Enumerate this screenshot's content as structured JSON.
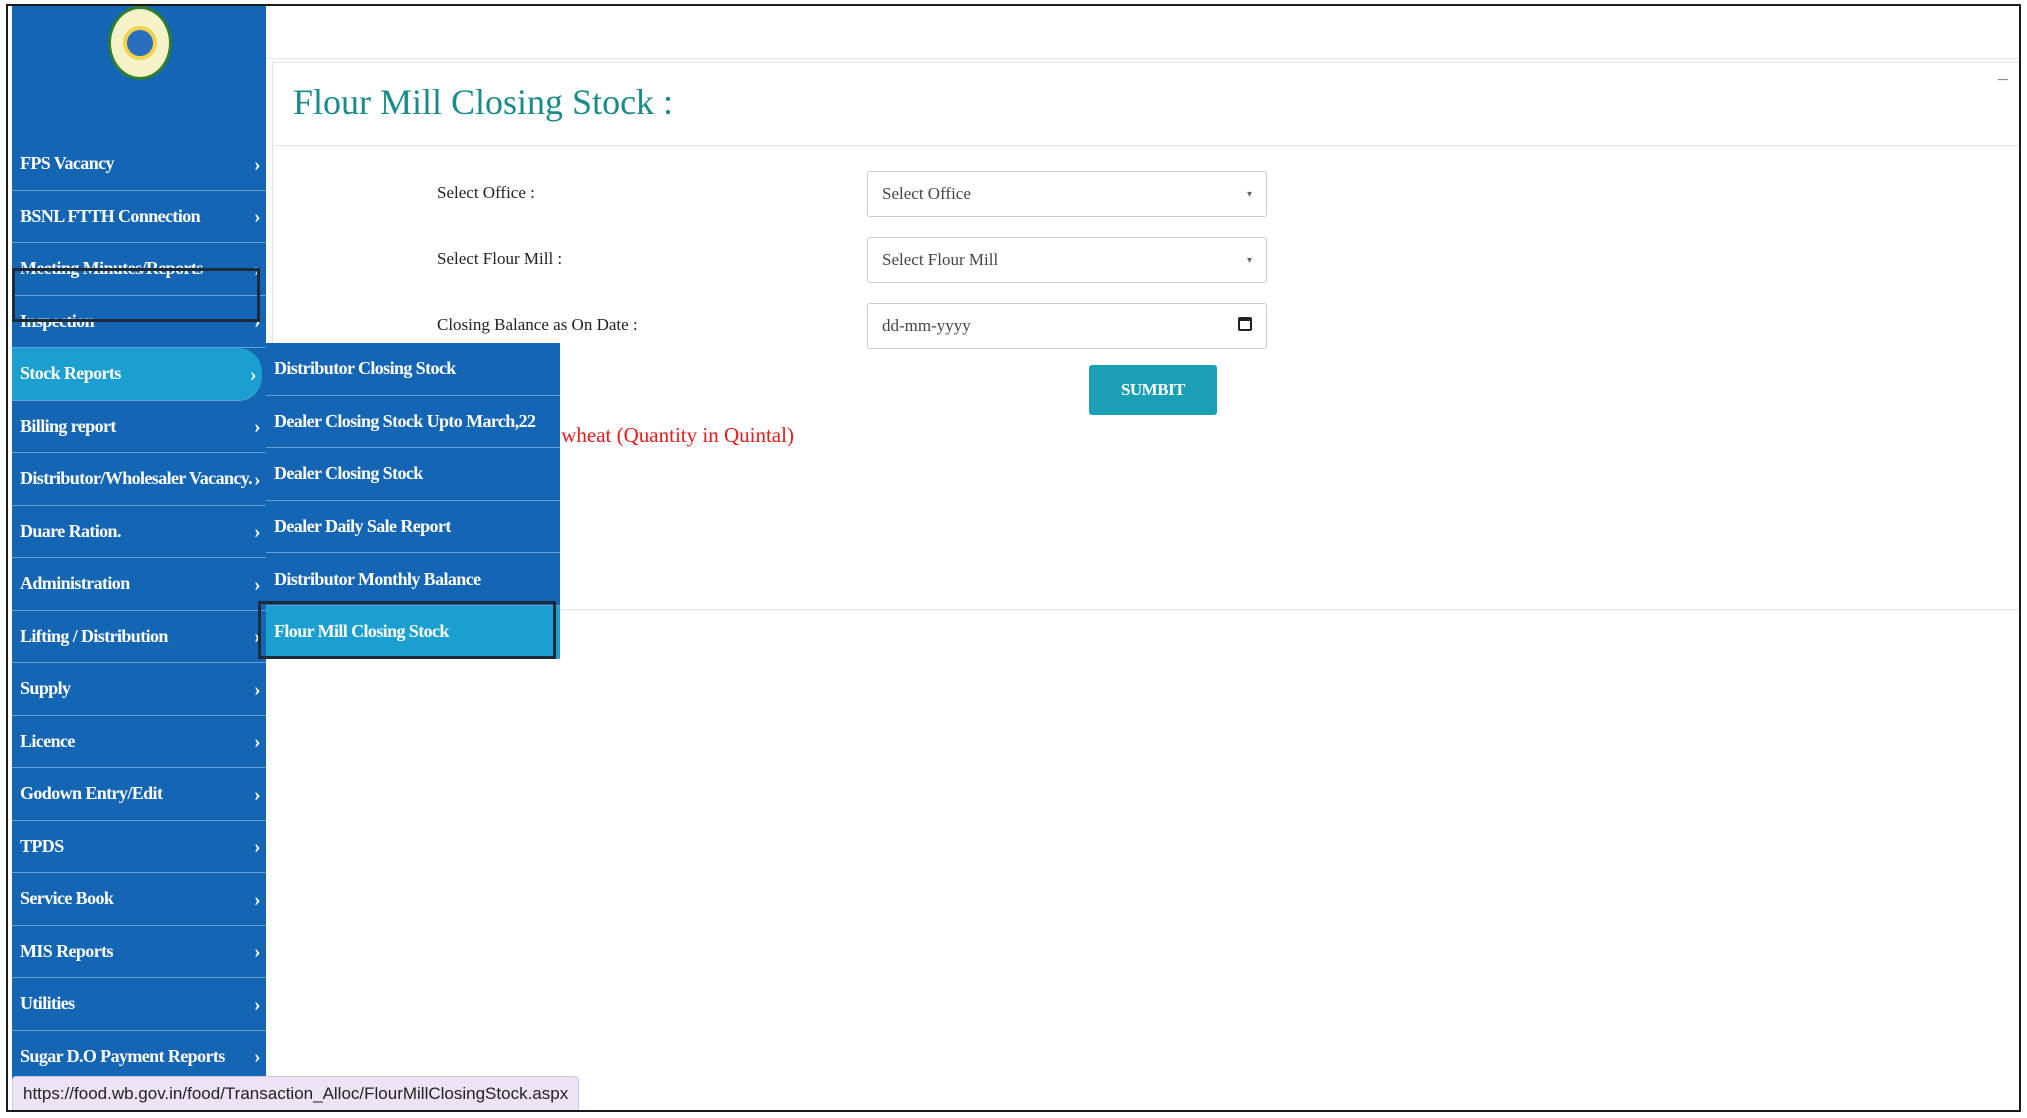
{
  "page": {
    "title": "Flour Mill Closing Stock :",
    "collapse_icon": "−"
  },
  "sidebar": {
    "items": [
      {
        "label": "FPS Vacancy"
      },
      {
        "label": "BSNL FTTH Connection"
      },
      {
        "label": "Meeting Minutes/Reports"
      },
      {
        "label": "Inspection"
      },
      {
        "label": "Stock Reports"
      },
      {
        "label": "Billing report"
      },
      {
        "label": "Distributor/Wholesaler Vacancy."
      },
      {
        "label": "Duare Ration."
      },
      {
        "label": "Administration"
      },
      {
        "label": "Lifting / Distribution"
      },
      {
        "label": "Supply"
      },
      {
        "label": "Licence"
      },
      {
        "label": "Godown Entry/Edit"
      },
      {
        "label": "TPDS"
      },
      {
        "label": "Service Book"
      },
      {
        "label": "MIS Reports"
      },
      {
        "label": "Utilities"
      },
      {
        "label": "Sugar D.O Payment Reports"
      }
    ],
    "active_item": "Stock Reports",
    "chevron": "›"
  },
  "submenu": {
    "items": [
      {
        "label": "Distributor Closing Stock"
      },
      {
        "label": "Dealer Closing Stock Upto March,22"
      },
      {
        "label": "Dealer Closing Stock"
      },
      {
        "label": "Dealer Daily Sale Report"
      },
      {
        "label": "Distributor Monthly Balance"
      },
      {
        "label": "Flour Mill Closing Stock"
      }
    ],
    "active_item": "Flour Mill Closing Stock"
  },
  "form": {
    "office_label": "Select Office :",
    "office_value": "Select Office",
    "mill_label": "Select Flour Mill :",
    "mill_value": "Select Flour Mill",
    "date_label": "Closing Balance as On Date :",
    "date_placeholder": "dd-mm-yyyy",
    "submit_label": "SUMBIT",
    "note_text": "f wheat (Quantity in Quintal)"
  },
  "statusbar": {
    "url": "https://food.wb.gov.in/food/Transaction_Alloc/FlourMillClosingStock.aspx"
  },
  "colors": {
    "sidebar_bg": "#1565b5",
    "active_bg": "#1a9fd0",
    "title_color": "#1b8a8a",
    "note_color": "#e51a1a",
    "button_bg": "#1a9fb5"
  },
  "icons": {
    "caret": "▾",
    "calendar": "calendar-icon",
    "logo": "emblem-logo"
  }
}
